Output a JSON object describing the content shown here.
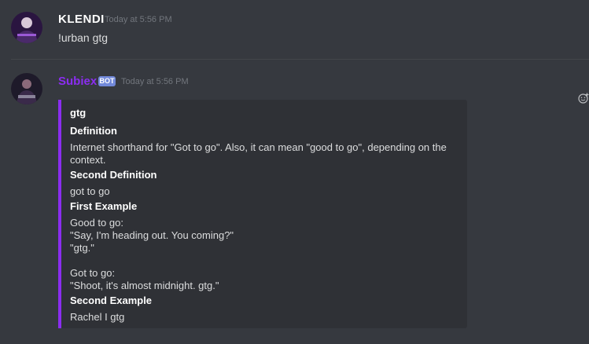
{
  "messages": [
    {
      "author": "KLENDI",
      "timestamp": "Today at 5:56 PM",
      "text": "!urban gtg"
    },
    {
      "author": "Subiex",
      "badge": "BOT",
      "timestamp": "Today at 5:56 PM",
      "embed": {
        "title": "gtg",
        "definition_label": "Definition",
        "definition_line1": "Internet shorthand for \"Got to go\". Also, it can mean \"good to go\", depending on the",
        "definition_line2": "context.",
        "second_definition_label": "Second Definition",
        "second_definition_value": "got to go",
        "first_example_label": "First Example",
        "first_example_line1": "Good to go:",
        "first_example_line2": "\"Say, I'm heading out. You coming?\"",
        "first_example_line3": "\"gtg.\"",
        "first_example_line4": "Got to go:",
        "first_example_line5": "\"Shoot, it's almost midnight. gtg.\"",
        "second_example_label": "Second Example",
        "second_example_value": "Rachel I gtg"
      }
    }
  ],
  "colors": {
    "background": "#36393f",
    "embed_background": "#2f3136",
    "embed_accent": "#8b2df1",
    "bot_username": "#8b2df1",
    "bot_badge": "#7289da",
    "text": "#dcddde",
    "timestamp": "#72767d"
  },
  "icons": {
    "reaction": "add-reaction-icon"
  }
}
